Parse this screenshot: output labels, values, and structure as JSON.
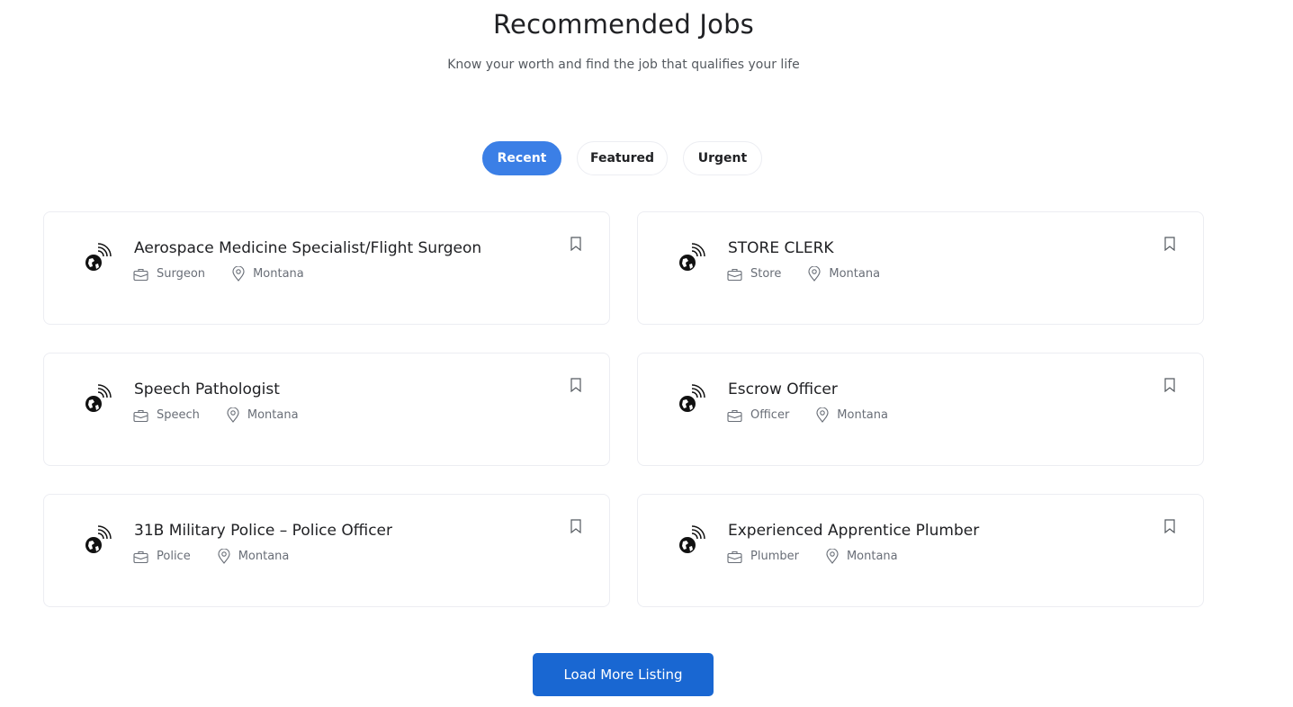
{
  "section": {
    "title": "Recommended Jobs",
    "subtitle": "Know your worth and find the job that qualifies your life"
  },
  "tabs": [
    {
      "label": "Recent",
      "active": true
    },
    {
      "label": "Featured",
      "active": false
    },
    {
      "label": "Urgent",
      "active": false
    }
  ],
  "jobs": [
    {
      "title": "Aerospace Medicine Specialist/Flight Surgeon",
      "category": "Surgeon",
      "location": "Montana"
    },
    {
      "title": "STORE CLERK",
      "category": "Store",
      "location": "Montana"
    },
    {
      "title": "Speech Pathologist",
      "category": "Speech",
      "location": "Montana"
    },
    {
      "title": "Escrow Officer",
      "category": "Officer",
      "location": "Montana"
    },
    {
      "title": "31B Military Police – Police Officer",
      "category": "Police",
      "location": "Montana"
    },
    {
      "title": "Experienced Apprentice Plumber",
      "category": "Plumber",
      "location": "Montana"
    }
  ],
  "icons": {
    "company_logo": "globe-signal-icon",
    "category": "briefcase-icon",
    "location": "map-pin-icon",
    "save": "bookmark-icon"
  },
  "load_more_label": "Load More Listing",
  "colors": {
    "accent": "#3b7fe6",
    "button": "#1967d2",
    "text": "#202124",
    "muted": "#696e77",
    "border": "#ecedf2"
  }
}
